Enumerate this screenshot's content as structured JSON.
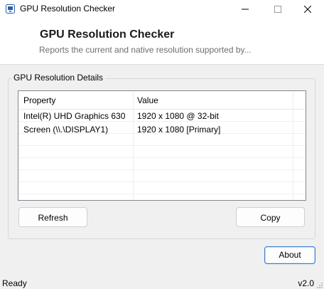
{
  "window": {
    "title": "GPU Resolution Checker"
  },
  "header": {
    "title": "GPU Resolution Checker",
    "subtitle": "Reports the current and native resolution supported by..."
  },
  "group": {
    "label": "GPU Resolution Details"
  },
  "list": {
    "columns": [
      "Property",
      "Value"
    ],
    "rows": [
      {
        "property": "Intel(R) UHD Graphics 630",
        "value": "1920 x 1080 @ 32-bit"
      },
      {
        "property": "Screen (\\\\.\\DISPLAY1)",
        "value": "1920 x 1080 [Primary]"
      }
    ]
  },
  "buttons": {
    "refresh": "Refresh",
    "copy": "Copy",
    "about": "About"
  },
  "status": {
    "text": "Ready",
    "version": "v2.0"
  },
  "colors": {
    "accent": "#3a7bd5",
    "window_bg": "#f0f0f0",
    "header_bg": "#ffffff"
  }
}
